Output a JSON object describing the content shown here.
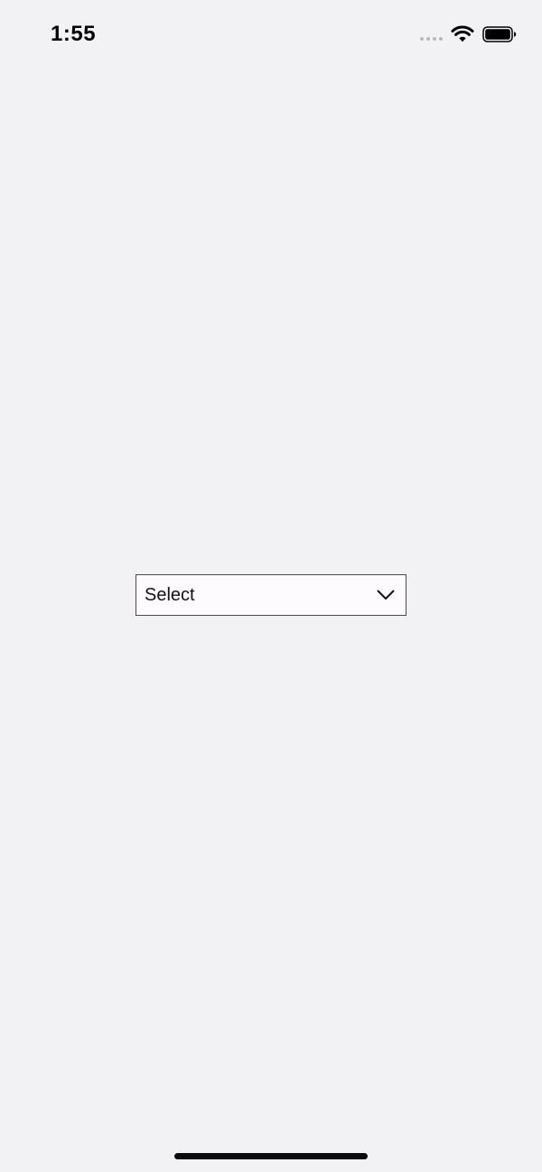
{
  "status_bar": {
    "time": "1:55",
    "icons": [
      "signal-dots-icon",
      "wifi-icon",
      "battery-icon"
    ]
  },
  "select": {
    "value": "Select",
    "icon": "chevron-down-icon"
  },
  "colors": {
    "background": "#f2f1f4",
    "select_background": "#fdfbfe",
    "select_border": "#4a4a4a",
    "text": "#111111",
    "home_indicator": "#0a0a0a"
  }
}
